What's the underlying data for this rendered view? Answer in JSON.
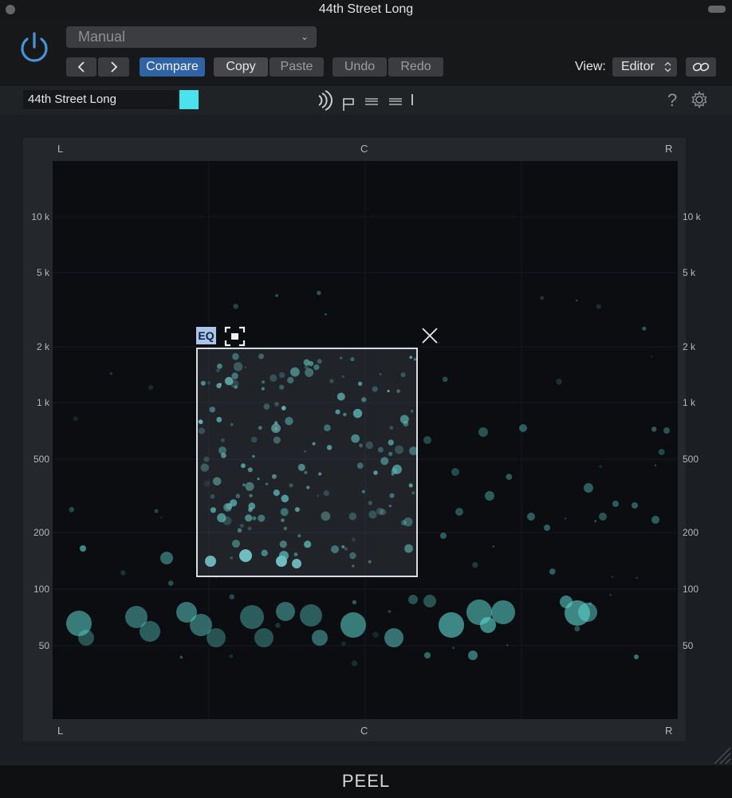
{
  "window": {
    "title": "44th Street Long"
  },
  "host": {
    "preset_value": "Manual",
    "buttons": {
      "back": "<",
      "forward": ">",
      "compare": "Compare",
      "copy": "Copy",
      "paste": "Paste",
      "undo": "Undo",
      "redo": "Redo"
    },
    "view_label": "View:",
    "view_value": "Editor"
  },
  "plugin": {
    "preset_name": "44th Street Long",
    "swatch_color": "#49e3ee",
    "logo_text": "peel",
    "help": "?"
  },
  "stage": {
    "top_labels": [
      "L",
      "C",
      "R"
    ],
    "bottom_labels": [
      "L",
      "C",
      "R"
    ],
    "freq_labels": [
      "10 k",
      "5 k",
      "2 k",
      "1 k",
      "500",
      "200",
      "100",
      "50"
    ]
  },
  "eq": {
    "badge": "EQ"
  },
  "footer": {
    "name": "PEEL"
  },
  "colors": {
    "accent": "#2f63a4",
    "blob": "#5fd8d2",
    "blob_bright": "#7ff0ec"
  }
}
